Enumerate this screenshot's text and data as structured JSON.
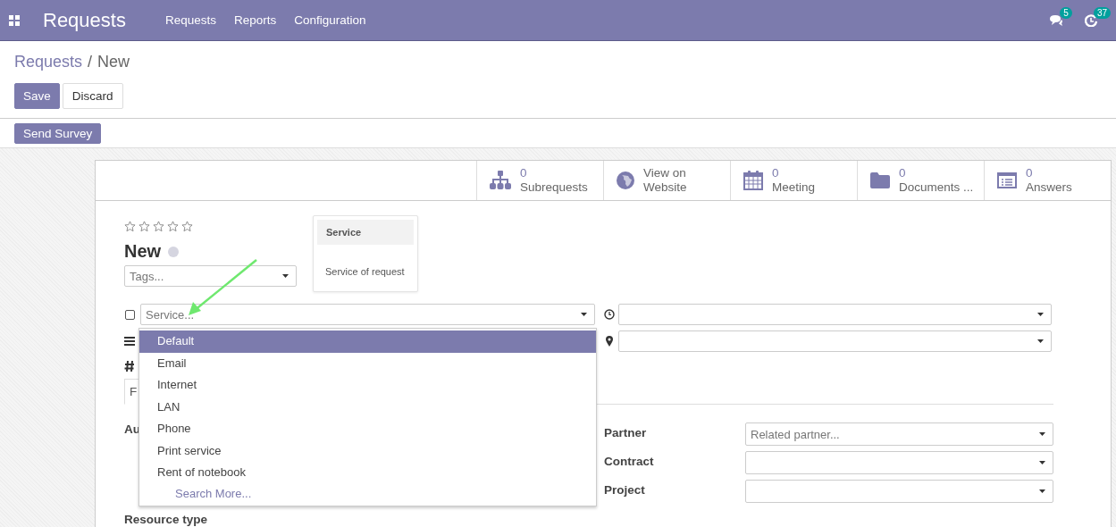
{
  "navbar": {
    "app_title": "Requests",
    "menu": [
      "Requests",
      "Reports",
      "Configuration"
    ],
    "chat_count": "5",
    "activity_count": "37"
  },
  "breadcrumb": {
    "parent": "Requests",
    "separator": "/",
    "current": "New"
  },
  "actions": {
    "save": "Save",
    "discard": "Discard",
    "send_survey": "Send Survey"
  },
  "smart_buttons": [
    {
      "kind": "subrequests",
      "count": "0",
      "label": "Subrequests"
    },
    {
      "kind": "website",
      "line1": "View on",
      "label": "Website"
    },
    {
      "kind": "meeting",
      "count": "0",
      "label": "Meeting"
    },
    {
      "kind": "documents",
      "count": "0",
      "label": "Documents ..."
    },
    {
      "kind": "answers",
      "count": "0",
      "label": "Answers"
    }
  ],
  "form": {
    "stars": 0,
    "title": "New",
    "tags_placeholder": "Tags...",
    "service_placeholder": "Service...",
    "service_checked": false,
    "tab_label": "F",
    "tab_selected": true,
    "author_label": "Au",
    "resource_label": "Resource type",
    "tooltip": {
      "title": "Service",
      "text": "Service of request"
    },
    "right_fields": [
      {
        "label": "Partner",
        "placeholder": "Related partner..."
      },
      {
        "label": "Contract"
      },
      {
        "label": "Project"
      }
    ]
  },
  "service_dropdown": {
    "items": [
      {
        "label": "Default",
        "selected": true
      },
      {
        "label": "Email",
        "selected": false
      },
      {
        "label": "Internet",
        "selected": false
      },
      {
        "label": "LAN",
        "selected": false
      },
      {
        "label": "Phone",
        "selected": false
      },
      {
        "label": "Print service",
        "selected": false
      },
      {
        "label": "Rent of notebook",
        "selected": false
      }
    ],
    "search_more": "Search More..."
  }
}
